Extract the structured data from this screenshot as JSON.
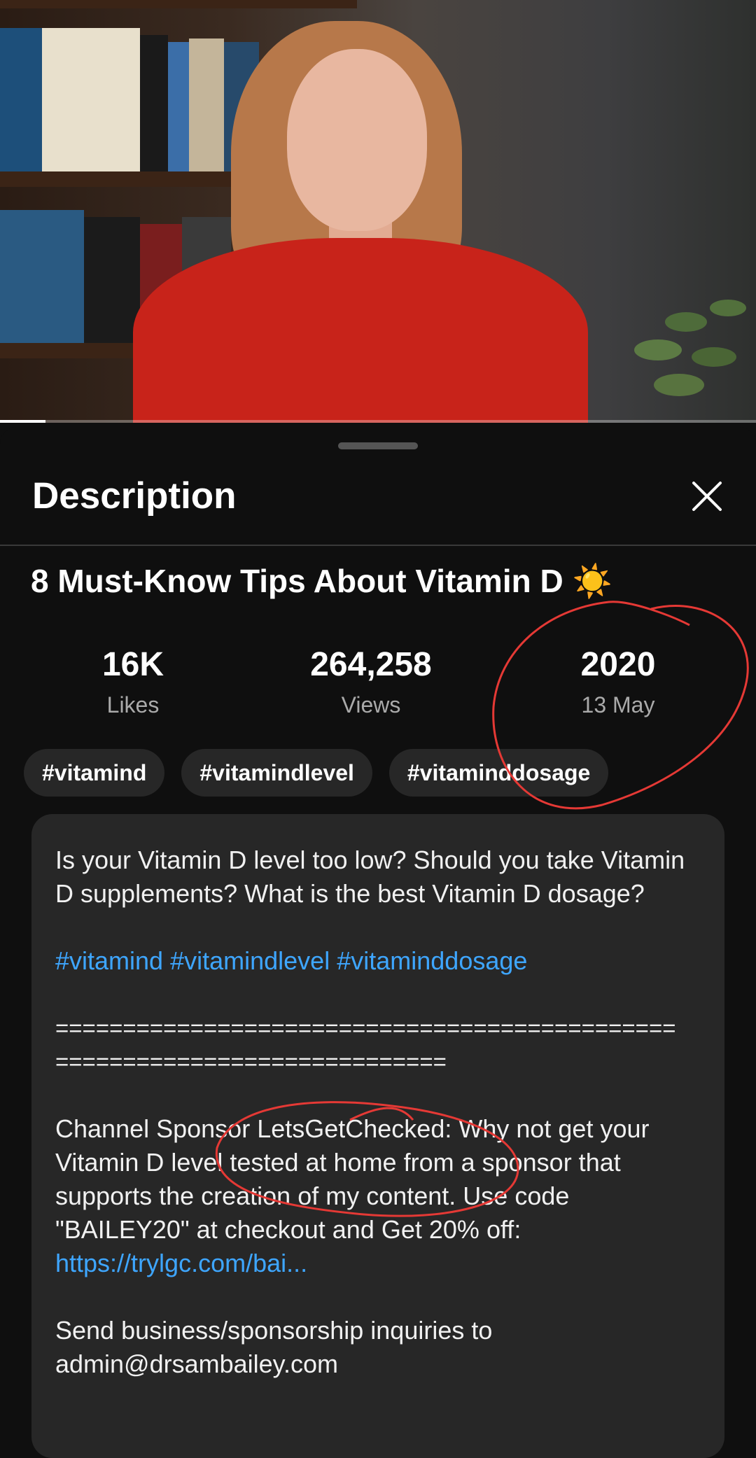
{
  "sheet": {
    "title": "Description",
    "close_icon": "close-icon"
  },
  "video": {
    "progress_fraction": 0.06,
    "title": "8 Must-Know Tips About Vitamin D ☀️"
  },
  "stats": [
    {
      "value": "16K",
      "label": "Likes"
    },
    {
      "value": "264,258",
      "label": "Views"
    },
    {
      "value": "2020",
      "label": "13 May"
    }
  ],
  "chips": [
    "#vitamind",
    "#vitamindlevel",
    "#vitaminddosage"
  ],
  "description": {
    "intro": "Is your Vitamin D level too low? Should you take Vitamin D supplements? What is the best Vitamin D dosage?",
    "hashtags": [
      "#vitamind",
      "#vitamindlevel",
      "#vitaminddosage"
    ],
    "separator_line1": "==============================================",
    "separator_line2": "=============================",
    "sponsor_text": "Channel Sponsor LetsGetChecked:  Why not get your Vitamin D level tested at home from a sponsor that supports the creation of my content.  Use code \"BAILEY20\" at checkout and Get 20% off:",
    "sponsor_link": "https://trylgc.com/bai...",
    "business_text": "Send business/sponsorship inquiries to admin@drsambailey.com"
  },
  "colors": {
    "background": "#0f0f0f",
    "card": "#272727",
    "link": "#3ea6ff",
    "annotation": "#e53935"
  }
}
